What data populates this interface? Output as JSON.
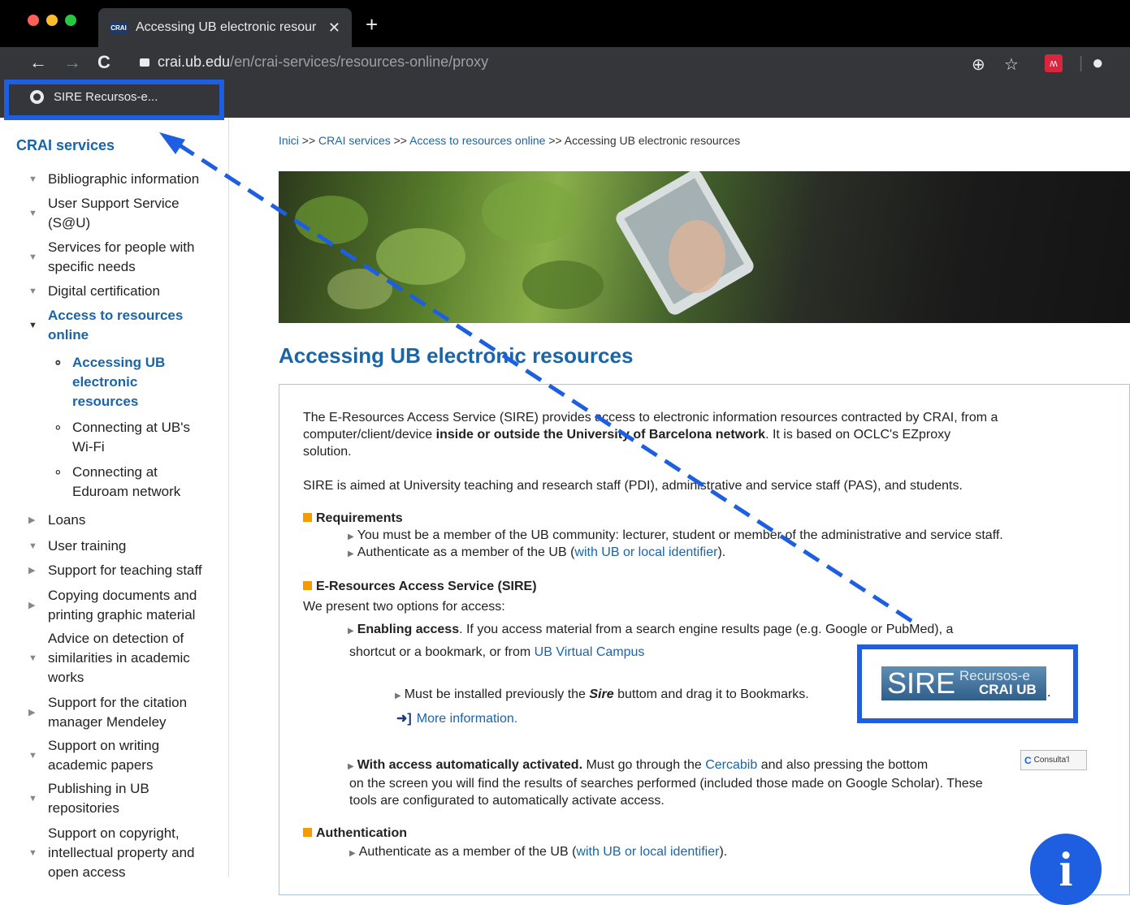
{
  "browser": {
    "tab_title": "Accessing UB electronic resour",
    "tab_favicon": "CRAI",
    "url_host": "crai.ub.edu",
    "url_path": "/en/crai-services/resources-online/proxy",
    "bookmark_label": "SIRE Recursos-e..."
  },
  "sidebar": {
    "title": "CRAI services",
    "items": [
      {
        "label": "Bibliographic information"
      },
      {
        "label": "User Support Service"
      },
      {
        "label": "(S@U)"
      },
      {
        "label": "Services for people with"
      },
      {
        "label": "specific needs"
      },
      {
        "label": "Digital certification"
      },
      {
        "label": "Access to resources"
      },
      {
        "label": "online"
      },
      {
        "label": "Loans"
      },
      {
        "label": "User training"
      },
      {
        "label": "Support for teaching staff"
      },
      {
        "label": "Copying documents and"
      },
      {
        "label": "printing graphic material"
      },
      {
        "label": "Advice on detection of"
      },
      {
        "label": "similarities in academic"
      },
      {
        "label": "works"
      },
      {
        "label": "Support for the citation"
      },
      {
        "label": "manager Mendeley"
      },
      {
        "label": "Support on writing"
      },
      {
        "label": "academic papers"
      },
      {
        "label": "Publishing in UB"
      },
      {
        "label": "repositories"
      },
      {
        "label": "Support on copyright,"
      },
      {
        "label": "intellectual property and"
      },
      {
        "label": "open access"
      }
    ],
    "subitems": [
      {
        "label": "Accessing UB"
      },
      {
        "label": "electronic"
      },
      {
        "label": "resources"
      },
      {
        "label": "Connecting at UB's"
      },
      {
        "label": "Wi-Fi"
      },
      {
        "label": "Connecting at"
      },
      {
        "label": "Eduroam network"
      }
    ]
  },
  "breadcrumb": {
    "home": "Inici",
    "sep": ">>",
    "l1": "CRAI services",
    "l2": "Access to resources online",
    "current": "Accessing UB electronic resources"
  },
  "main": {
    "title": "Accessing UB electronic resources",
    "intro1a": "The E-Resources Access Service (SIRE) provides access to electronic information resources contracted by CRAI, from a",
    "intro1b": "computer/client/device ",
    "intro1b_bold": "inside or outside the University of Barcelona network",
    "intro1c": ". It is based on OCLC's EZproxy",
    "intro1d": "solution.",
    "intro2": "SIRE is aimed at University teaching and research staff (PDI), administrative and service staff (PAS), and students.",
    "req_title": "Requirements",
    "req1": "You must be a member of the UB community: lecturer, student or member of the administrative and service staff.",
    "req2a": "Authenticate as a member of the UB (",
    "req2_link": "with UB or local identifier",
    "req2b": ").",
    "sire_title": "E-Resources Access Service (SIRE)",
    "sire_intro": "We present two options for access:",
    "opt1_bold": "Enabling access",
    "opt1a": ". If you access material from a search engine results page (e.g. Google or PubMed), a",
    "opt1b": "shortcut or a bookmark, or from ",
    "opt1_link": "UB Virtual Campus",
    "install_a": "Must be installed previously the ",
    "install_bold": "Sire",
    "install_b": " buttom and drag it to Bookmarks.",
    "install_dot": ".",
    "more_info": "More information.",
    "opt2_bold": "With access automatically activated.",
    "opt2a": " Must go through the ",
    "opt2_link": "Cercabib",
    "opt2b": " and also pressing the bottom",
    "opt2c": " on the screen you will find the results of searches performed (included those made on Google Scholar). These",
    "opt2d": "tools are configurated to automatically activate access.",
    "auth_title": "Authentication",
    "auth_a": "Authenticate as a member of the UB (",
    "auth_link": "with UB or local identifier",
    "auth_b": ").",
    "sire_button": {
      "big": "SIRE",
      "r1": "Recursos-e",
      "r2": "CRAI UB"
    },
    "consulta": "Consulta'l",
    "info_glyph": "i"
  },
  "colors": {
    "link": "#1a64a8",
    "highlight": "#1d5fe0",
    "bullet": "#f59b00"
  }
}
